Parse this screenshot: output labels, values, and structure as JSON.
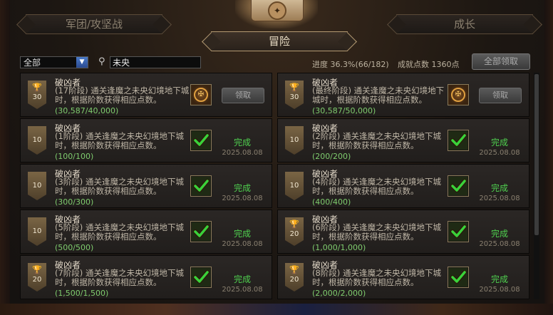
{
  "tabs": {
    "legion": "军团/攻坚战",
    "adventure": "冒险",
    "growth": "成长"
  },
  "filter": {
    "category": "全部",
    "search_value": "未央"
  },
  "summary": {
    "progress": "进度 36.3%(66/182)",
    "points": "成就点数 1360点",
    "claim_all": "全部领取"
  },
  "cards": [
    {
      "title": "破凶者",
      "desc": "(17阶段) 通关逢魔之未央幻境地下城时，根据阶数获得相应点数。",
      "progress": "(30,587/40,000)",
      "points": "30",
      "trophy": true,
      "status": "claim",
      "button": "领取"
    },
    {
      "title": "破凶者",
      "desc": "(最终阶段) 通关逢魔之未央幻境地下城时，根据阶数获得相应点数。",
      "progress": "(30,587/50,000)",
      "points": "30",
      "trophy": true,
      "status": "claim",
      "button": "领取"
    },
    {
      "title": "破凶者",
      "desc": "(1阶段) 通关逢魔之未央幻境地下城时，根据阶数获得相应点数。",
      "progress": "(100/100)",
      "points": "10",
      "trophy": false,
      "status": "done",
      "done": "完成",
      "date": "2025.08.08"
    },
    {
      "title": "破凶者",
      "desc": "(2阶段) 通关逢魔之未央幻境地下城时，根据阶数获得相应点数。",
      "progress": "(200/200)",
      "points": "10",
      "trophy": false,
      "status": "done",
      "done": "完成",
      "date": "2025.08.08"
    },
    {
      "title": "破凶者",
      "desc": "(3阶段) 通关逢魔之未央幻境地下城时，根据阶数获得相应点数。",
      "progress": "(300/300)",
      "points": "10",
      "trophy": false,
      "status": "done",
      "done": "完成",
      "date": "2025.08.08"
    },
    {
      "title": "破凶者",
      "desc": "(4阶段) 通关逢魔之未央幻境地下城时，根据阶数获得相应点数。",
      "progress": "(400/400)",
      "points": "10",
      "trophy": false,
      "status": "done",
      "done": "完成",
      "date": "2025.08.08"
    },
    {
      "title": "破凶者",
      "desc": "(5阶段) 通关逢魔之未央幻境地下城时，根据阶数获得相应点数。",
      "progress": "(500/500)",
      "points": "10",
      "trophy": false,
      "status": "done",
      "done": "完成",
      "date": "2025.08.08"
    },
    {
      "title": "破凶者",
      "desc": "(6阶段) 通关逢魔之未央幻境地下城时，根据阶数获得相应点数。",
      "progress": "(1,000/1,000)",
      "points": "20",
      "trophy": true,
      "status": "done",
      "done": "完成",
      "date": "2025.08.08"
    },
    {
      "title": "破凶者",
      "desc": "(7阶段) 通关逢魔之未央幻境地下城时，根据阶数获得相应点数。",
      "progress": "(1,500/1,500)",
      "points": "20",
      "trophy": true,
      "status": "done",
      "done": "完成",
      "date": "2025.08.08"
    },
    {
      "title": "破凶者",
      "desc": "(8阶段) 通关逢魔之未央幻境地下城时，根据阶数获得相应点数。",
      "progress": "(2,000/2,000)",
      "points": "20",
      "trophy": true,
      "status": "done",
      "done": "完成",
      "date": "2025.08.08"
    }
  ],
  "icons": {
    "trophy": "trophy-icon",
    "emblem": "dungeon-emblem-icon",
    "check": "check-icon",
    "search": "search-icon",
    "dropdown": "chevron-down-icon"
  },
  "colors": {
    "done_green": "#4fd04f",
    "progress_green": "#7fcc6e"
  }
}
